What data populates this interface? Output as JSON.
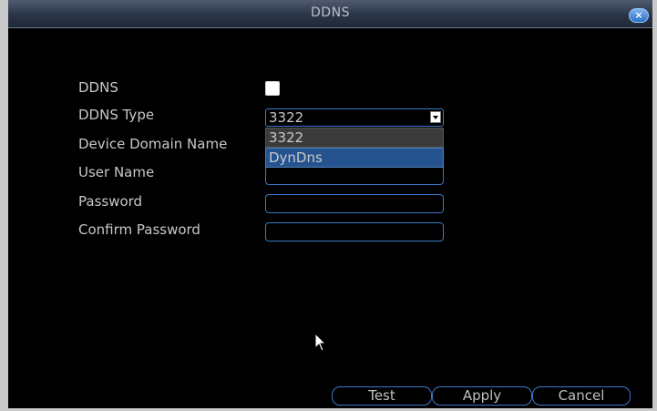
{
  "dialog": {
    "title": "DDNS",
    "close_label": "×"
  },
  "form": {
    "ddns_label": "DDNS",
    "ddns_checked": false,
    "type_label": "DDNS Type",
    "type_value": "3322",
    "domain_label": "Device Domain Name",
    "domain_value": "",
    "user_label": "User Name",
    "user_value": "",
    "password_label": "Password",
    "password_value": "",
    "confirm_label": "Confirm Password",
    "confirm_value": ""
  },
  "dropdown": {
    "options": [
      "3322",
      "DynDns"
    ],
    "highlighted": "DynDns"
  },
  "buttons": {
    "test": "Test",
    "apply": "Apply",
    "cancel": "Cancel"
  },
  "colors": {
    "accent": "#3a78c8",
    "highlight": "#25538f",
    "background": "#000000"
  }
}
